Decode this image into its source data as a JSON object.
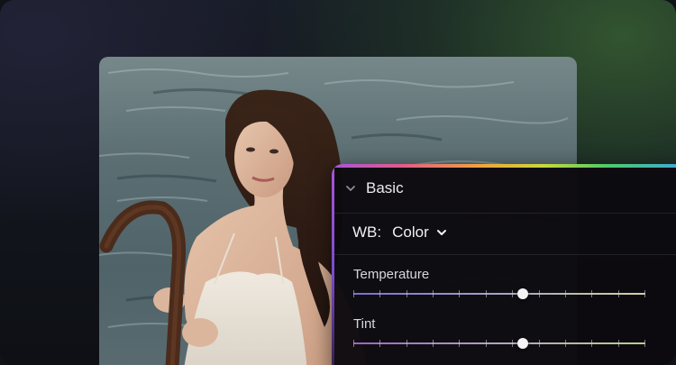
{
  "panel": {
    "section_title": "Basic",
    "section_icon": "chevron-down-icon",
    "white_balance": {
      "label": "WB:",
      "value": "Color",
      "icon": "chevron-down-icon"
    },
    "sliders": [
      {
        "label": "Temperature",
        "value": 0.58,
        "ticks": 12
      },
      {
        "label": "Tint",
        "value": 0.58,
        "ticks": 12
      }
    ]
  },
  "colors": {
    "accent_gradient": [
      "#a855d9",
      "#e25b8a",
      "#f2a33a",
      "#c8d83a",
      "#4ecb6a",
      "#3fa6e0"
    ],
    "panel_background": "#0c0a0e",
    "text": "#f1eff4"
  }
}
